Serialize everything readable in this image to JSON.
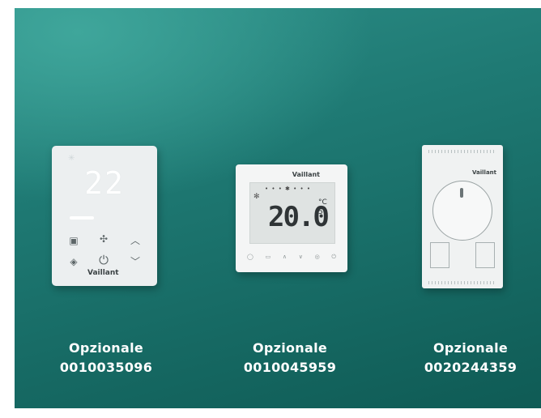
{
  "products": [
    {
      "label": "Opzionale",
      "code": "0010035096",
      "display_value": "22",
      "brand": "Vaillant",
      "icons": [
        "snowflake-icon",
        "mode-icon",
        "fan-icon",
        "chevron-up-icon",
        "drop-icon",
        "power-icon",
        "chevron-down-icon"
      ]
    },
    {
      "label": "Opzionale",
      "code": "0010045959",
      "display_value": "20.0",
      "display_unit": "°C",
      "display_secondary": "50",
      "brand": "Vaillant",
      "icons": [
        "snowflake-icon",
        "fan-icon",
        "power-icon"
      ]
    },
    {
      "label": "Opzionale",
      "code": "0020244359",
      "brand": "Vaillant",
      "icons": [
        "dial-icon"
      ]
    }
  ],
  "colors": {
    "background_top": "#3fa69b",
    "background_bottom": "#0f5b55",
    "text": "#ffffff"
  }
}
